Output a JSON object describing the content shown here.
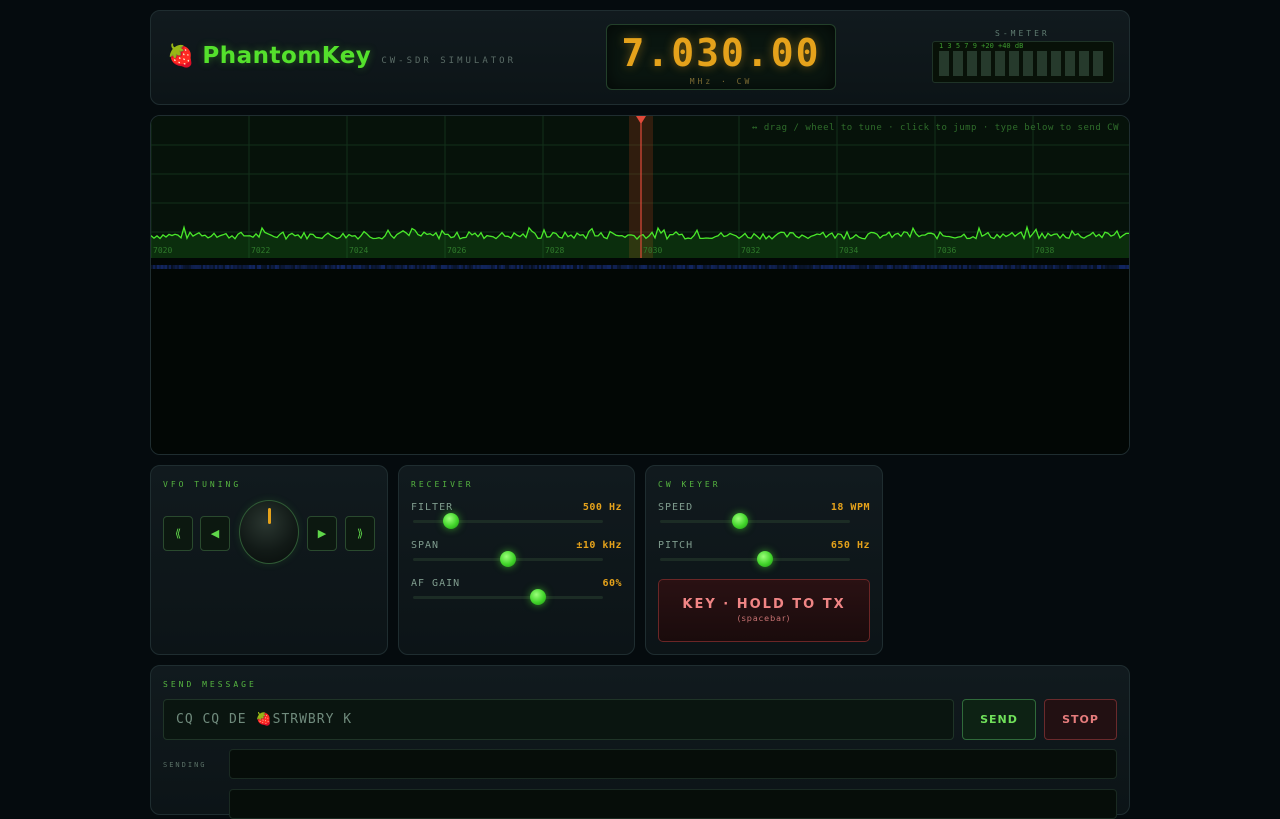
{
  "header": {
    "app_icon": "strawberry-icon",
    "title": "PhantomKey",
    "subtitle": "CW-SDR SIMULATOR",
    "frequency": "7.030.00",
    "frequency_unit": "MHz · CW",
    "smeter_title": "S-METER",
    "smeter_scale": "1 3 5 7 9 +20 +40 dB"
  },
  "spectrum": {
    "hint": "↔ drag / wheel to tune · click to jump · type below to send CW",
    "tick_labels": [
      "7020",
      "7022",
      "7024",
      "7026",
      "7028",
      "7030",
      "7032",
      "7034",
      "7036",
      "7038"
    ],
    "tuned_khz": 7030,
    "range_khz": [
      7020,
      7040
    ]
  },
  "vfo": {
    "title": "VFO TUNING",
    "buttons": [
      "⟪",
      "◀",
      "▶",
      "⟫"
    ]
  },
  "receiver": {
    "title": "RECEIVER",
    "filter_label": "FILTER",
    "filter_value": "500 Hz",
    "filter_level": 0.2,
    "span_label": "SPAN",
    "span_value": "±10 kHz",
    "span_level": 0.5,
    "af_label": "AF GAIN",
    "af_value": "60%",
    "af_level": 0.66
  },
  "keyer": {
    "title": "CW KEYER",
    "speed_label": "SPEED",
    "speed_value": "18 WPM",
    "speed_level": 0.42,
    "pitch_label": "PITCH",
    "pitch_value": "650 Hz",
    "pitch_level": 0.55,
    "key_label": "KEY · HOLD TO TX",
    "key_sub": "(spacebar)"
  },
  "send": {
    "title": "SEND MESSAGE",
    "placeholder": "CQ CQ DE 🍓STRWBRY K",
    "send_label": "SEND",
    "stop_label": "STOP",
    "sending_label": "SENDING"
  },
  "colors": {
    "accent_green": "#54e12c",
    "amber": "#e5a21b",
    "tx_red": "#f08585"
  }
}
